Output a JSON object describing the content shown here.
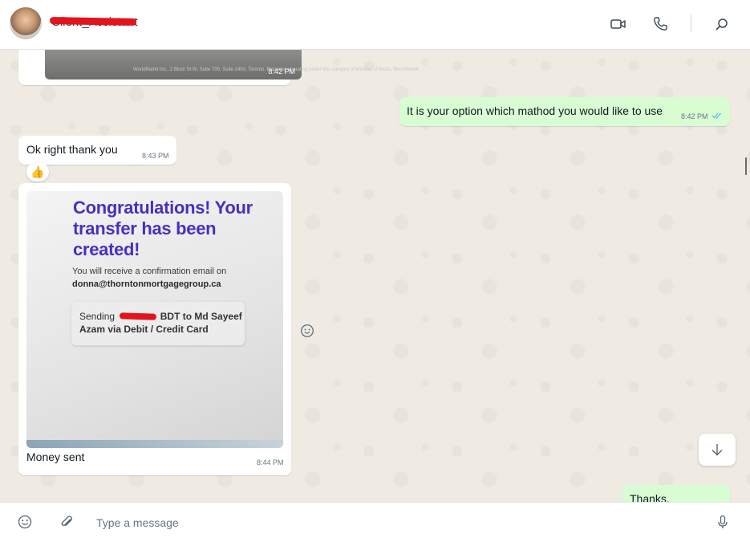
{
  "header": {
    "contact_name": "Client_Assistant"
  },
  "messages": {
    "img_time": "8:42 PM",
    "img_fine_print": "WorldRemit Inc., 2 Bloor St W, Suite 700, Suite 2400, Toronto. Business operating under the category of transfer of funds. WorldRemit",
    "out1_text": "It is your option which mathod you would like to use",
    "out1_time": "8:42 PM",
    "in1_text": "Ok right thank you",
    "in1_time": "8:43 PM",
    "reaction_emoji": "👍",
    "photo": {
      "headline": "Congratulations! Your transfer has been created!",
      "confirm_line": "You will receive a confirmation email on",
      "email": "donna@thorntonmortgagegroup.ca",
      "sending_prefix": "Sending",
      "sending_suffix": "BDT to Md Sayeef",
      "sending_line2": "Azam via Debit / Credit Card"
    },
    "photo_caption": "Money sent",
    "photo_time": "8:44 PM",
    "out2_text": "Thanks,"
  },
  "composer": {
    "placeholder": "Type a message"
  },
  "colors": {
    "chat_bg": "#efeae2",
    "outgoing_bubble": "#d9fdd3",
    "incoming_bubble": "#ffffff",
    "read_ticks": "#53bdeb",
    "redaction": "#e3141c",
    "headline_purple": "#4a2fbf"
  },
  "icons": {
    "video": "video-call-icon",
    "voice": "voice-call-icon",
    "search": "search-icon",
    "emoji": "emoji-icon",
    "attach": "paperclip-icon",
    "mic": "microphone-icon",
    "scroll": "arrow-down-icon",
    "react": "smiley-react-icon",
    "ticks": "double-check-icon"
  }
}
